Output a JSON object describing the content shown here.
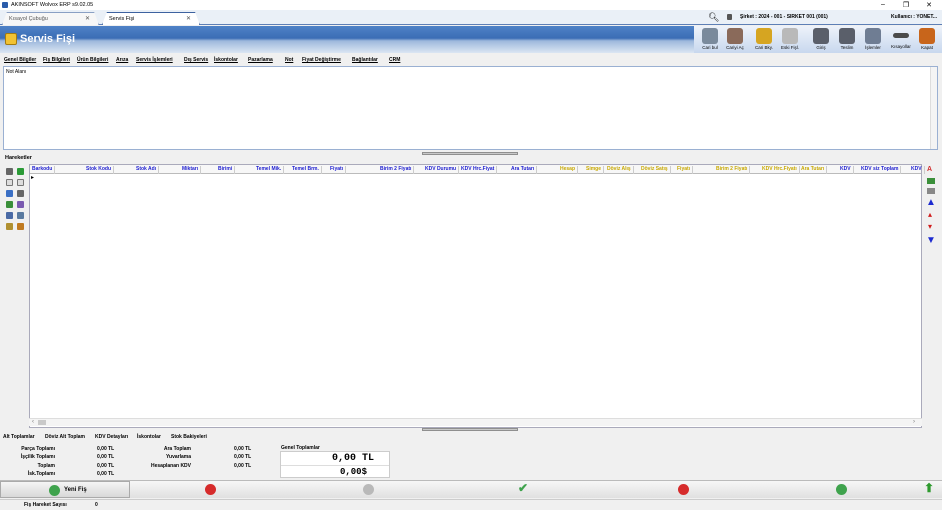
{
  "window": {
    "title": "AKINSOFT Wolvox ERP s9.02.05",
    "min": "–",
    "max": "❐",
    "close": "✕"
  },
  "tabs": [
    {
      "label": "Kısayol Çubuğu"
    },
    {
      "label": "Servis Fişi"
    }
  ],
  "header": {
    "company": "Şirket : 2024 - 001 - SIRKET 001 (001)",
    "user": "Kullanıcı : YONET..."
  },
  "page": {
    "title": "Servis Fişi"
  },
  "toolbar": [
    {
      "label": "Cari bul",
      "icon": "search-person-icon"
    },
    {
      "label": "Cariyi Aç",
      "icon": "open-person-icon"
    },
    {
      "label": "Cari Bky.",
      "icon": "balance-icon"
    },
    {
      "label": "Eski Fişl.",
      "icon": "old-docs-icon"
    },
    {
      "label": "Giriş",
      "icon": "printer-in-icon"
    },
    {
      "label": "Teslim",
      "icon": "printer-out-icon"
    },
    {
      "label": "İşlemler",
      "icon": "tools-icon"
    },
    {
      "label": "Kısayollar",
      "icon": "shortcut-icon"
    },
    {
      "label": "Kapat",
      "icon": "exit-door-icon"
    }
  ],
  "menu": [
    "Genel Bilgiler",
    "Fiş Bilgileri",
    "Ürün Bilgileri",
    "Arıza",
    "Servis İşlemleri",
    "Dış Servis",
    "İskontolar",
    "Pazarlama",
    "Not",
    "Fiyat Değiştirme",
    "Bağlantılar",
    "CRM"
  ],
  "note": {
    "label": "Not Alanı"
  },
  "movements": {
    "label": "Hareketler"
  },
  "columns": [
    {
      "t": "Barkodu",
      "y": false
    },
    {
      "t": "Stok Kodu",
      "y": false
    },
    {
      "t": "Stok Adı",
      "y": false
    },
    {
      "t": "Miktarı",
      "y": false
    },
    {
      "t": "Birimi",
      "y": false
    },
    {
      "t": "Temel Mik.",
      "y": false
    },
    {
      "t": "Temel Brm.",
      "y": false
    },
    {
      "t": "Fiyatı",
      "y": false
    },
    {
      "t": "Birim 2 Fiyatı",
      "y": false
    },
    {
      "t": "KDV Durumu",
      "y": false
    },
    {
      "t": "KDV Hrc.Fiyat",
      "y": false
    },
    {
      "t": "Ara Tutarı",
      "y": false
    },
    {
      "t": "Hesap",
      "y": true
    },
    {
      "t": "Simge",
      "y": true
    },
    {
      "t": "Döviz Alış",
      "y": true
    },
    {
      "t": "Döviz Satış",
      "y": true
    },
    {
      "t": "Fiyatı",
      "y": true
    },
    {
      "t": "Birim 2 Fiyatı",
      "y": true
    },
    {
      "t": "KDV Hrc.Fiyatı",
      "y": true
    },
    {
      "t": "Ara Tutarı",
      "y": true
    },
    {
      "t": "KDV",
      "y": false
    },
    {
      "t": "KDV siz Toplam",
      "y": false
    },
    {
      "t": "KDV",
      "y": false
    }
  ],
  "bottomTabs": [
    "Alt Toplamlar",
    "Döviz Alt Toplam",
    "KDV Detayları",
    "İskontolar",
    "Stok Bakiyeleri"
  ],
  "totals": {
    "left": [
      {
        "l": "Parça Toplamı",
        "v": "0,00 TL"
      },
      {
        "l": "İşçilik Toplamı",
        "v": "0,00 TL"
      },
      {
        "l": "Toplam",
        "v": "0,00 TL"
      },
      {
        "l": "İsk.Toplamı",
        "v": "0,00 TL"
      }
    ],
    "mid": [
      {
        "l": "Ara Toplam",
        "v": "0,00 TL"
      },
      {
        "l": "Yuvarlama",
        "v": "0,00 TL"
      },
      {
        "l": "Hesaplanan KDV",
        "v": "0,00 TL"
      }
    ],
    "grand": {
      "title": "Genel Toplamlar",
      "tl": "0,00 TL",
      "usd": "0,00$"
    }
  },
  "footer": {
    "new": "Yeni Fiş"
  },
  "status": {
    "label": "Fiş Hareket Sayısı",
    "value": "0"
  }
}
